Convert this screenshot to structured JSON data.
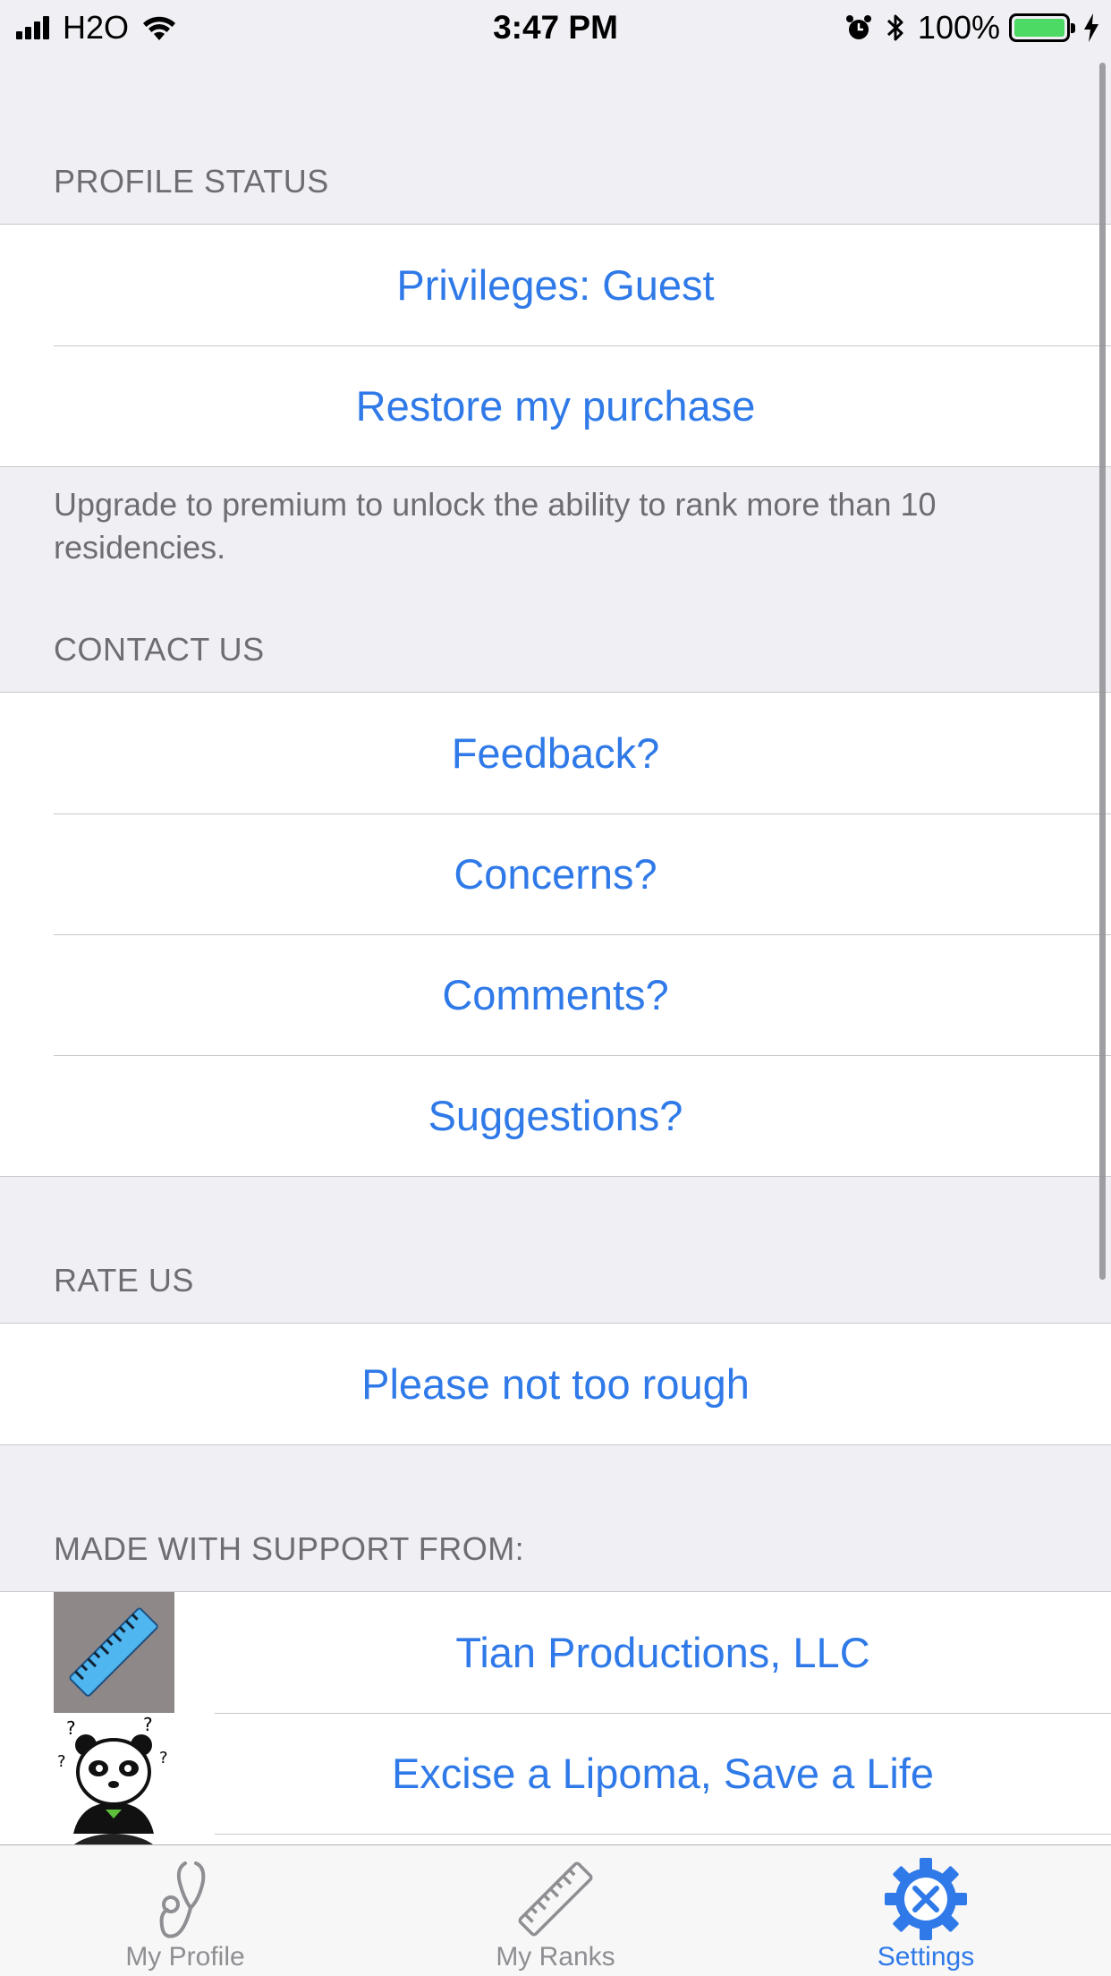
{
  "status_bar": {
    "carrier": "H2O",
    "time": "3:47 PM",
    "battery_percent": "100%",
    "battery_level": 1.0,
    "icons": [
      "signal-icon",
      "wifi-icon",
      "alarm-icon",
      "bluetooth-icon",
      "battery-icon",
      "charging-icon"
    ]
  },
  "sections": {
    "profile_status": {
      "header": "PROFILE STATUS",
      "items": [
        "Privileges: Guest",
        "Restore my purchase"
      ],
      "footer": "Upgrade to premium to unlock the ability to rank more than 10 residencies."
    },
    "contact_us": {
      "header": "CONTACT US",
      "items": [
        "Feedback?",
        "Concerns?",
        "Comments?",
        "Suggestions?"
      ]
    },
    "rate_us": {
      "header": "RATE US",
      "items": [
        "Please not too rough"
      ]
    },
    "support": {
      "header": "MADE WITH SUPPORT FROM:",
      "items": [
        {
          "label": "Tian Productions, LLC",
          "icon": "ruler-logo-icon"
        },
        {
          "label": "Excise a Lipoma, Save a Life",
          "icon": "panda-logo-icon"
        }
      ]
    }
  },
  "tab_bar": {
    "tabs": [
      {
        "label": "My Profile",
        "icon": "stethoscope-icon",
        "selected": false
      },
      {
        "label": "My Ranks",
        "icon": "ruler-icon",
        "selected": false
      },
      {
        "label": "Settings",
        "icon": "settings-gear-icon",
        "selected": true
      }
    ]
  },
  "colors": {
    "accent": "#2f7ae8",
    "background": "#efeff4",
    "header_text": "#6d6d72",
    "tab_inactive": "#8e8e93",
    "battery_fill": "#4cd964"
  }
}
